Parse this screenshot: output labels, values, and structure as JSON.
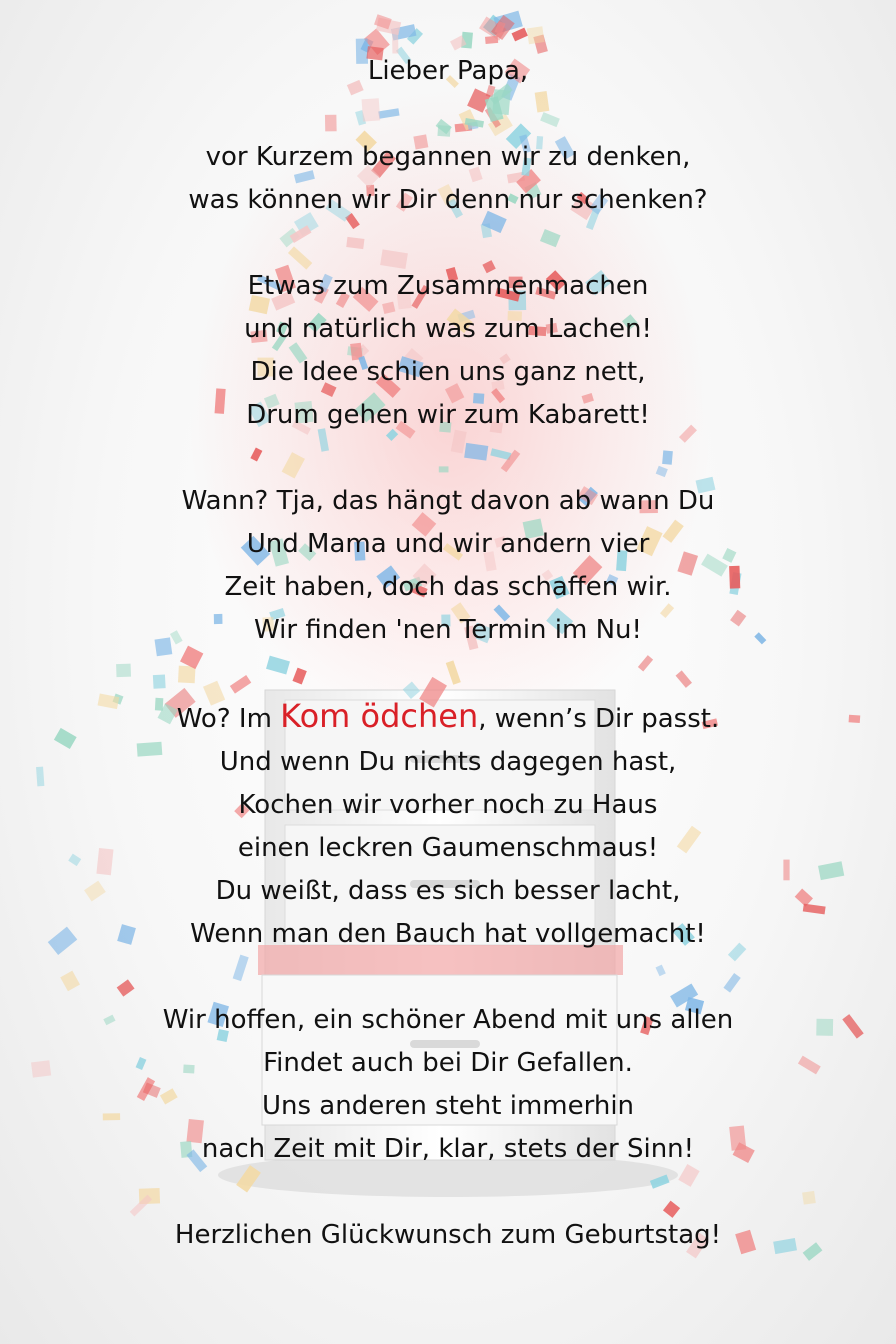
{
  "poem": {
    "salutation": "Lieber Papa,",
    "stanza1": [
      "vor Kurzem begannen wir zu denken,",
      "was können wir Dir denn nur schenken?"
    ],
    "stanza2": [
      "Etwas zum Zusammenmachen",
      "und natürlich was zum Lachen!",
      "Die Idee schien uns ganz nett,",
      "Drum gehen wir zum Kabarett!"
    ],
    "stanza3": [
      "Wann? Tja, das hängt davon ab wann Du",
      "Und Mama und wir andern vier",
      "Zeit haben, doch das schaffen wir.",
      "Wir finden 'nen Termin im Nu!"
    ],
    "stanza4": {
      "first_line_prefix": "Wo? Im ",
      "venue_name": "Kom ödchen",
      "first_line_suffix": ", wenn’s Dir passt.",
      "lines": [
        "Und wenn Du nichts dagegen hast,",
        "Kochen wir vorher noch zu Haus",
        "einen leckren Gaumenschmaus!",
        "Du weißt, dass es sich besser lacht,",
        "Wenn man den Bauch hat vollgemacht!"
      ]
    },
    "stanza5": [
      "Wir hoffen, ein schöner Abend mit uns allen",
      "Findet auch bei Dir Gefallen.",
      "Uns anderen steht immerhin",
      "nach Zeit mit Dir, klar, stets der Sinn!"
    ],
    "closing": "Herzlichen Glückwunsch zum Geburtstag!"
  },
  "colors": {
    "text": "#111111",
    "highlight": "#d92027",
    "confetti": [
      "#f08a8a",
      "#e65c5c",
      "#8fd3e0",
      "#9ad7c2",
      "#f4c6c6",
      "#7fb7e6",
      "#f3d9a4"
    ]
  }
}
